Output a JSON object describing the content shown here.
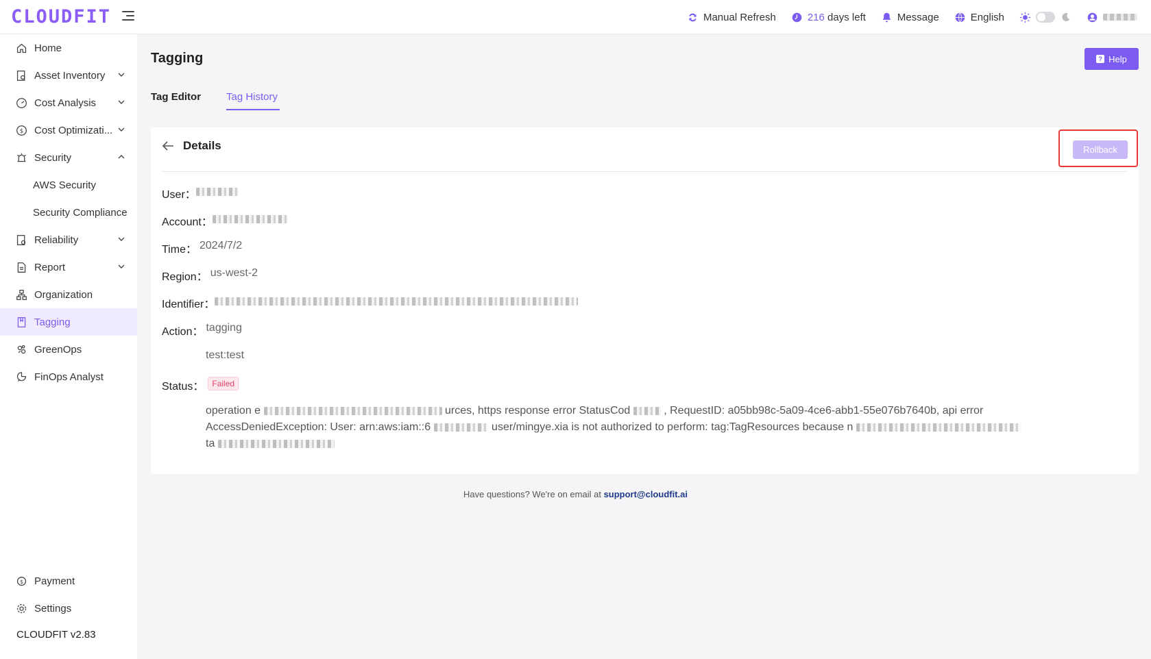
{
  "header": {
    "logo": "CLOUDFIT",
    "manual_refresh": "Manual Refresh",
    "days_num": "216",
    "days_label": "days left",
    "message": "Message",
    "language": "English"
  },
  "sidebar": {
    "items": [
      {
        "label": "Home"
      },
      {
        "label": "Asset Inventory"
      },
      {
        "label": "Cost Analysis"
      },
      {
        "label": "Cost Optimizati..."
      },
      {
        "label": "Security"
      },
      {
        "label": "AWS Security"
      },
      {
        "label": "Security Compliance"
      },
      {
        "label": "Reliability"
      },
      {
        "label": "Report"
      },
      {
        "label": "Organization"
      },
      {
        "label": "Tagging"
      },
      {
        "label": "GreenOps"
      },
      {
        "label": "FinOps Analyst"
      }
    ],
    "payment": "Payment",
    "settings": "Settings",
    "version": "CLOUDFIT v2.83"
  },
  "page": {
    "title": "Tagging",
    "help": "Help",
    "tabs": [
      {
        "label": "Tag Editor"
      },
      {
        "label": "Tag History"
      }
    ],
    "active_tab": "Tag History"
  },
  "details": {
    "title": "Details",
    "rollback": "Rollback",
    "user_label": "User：",
    "account_label": "Account：",
    "time_label": "Time：",
    "time_value": "2024/7/2",
    "region_label": "Region：",
    "region_value": "us-west-2",
    "identifier_label": "Identifier：",
    "action_label": "Action：",
    "action_value": "tagging",
    "tag_value": "test:test",
    "status_label": "Status：",
    "status_value": "Failed",
    "error_line1_a": "operation e",
    "error_line1_b": "urces, https response error StatusCod",
    "error_line1_c": ", RequestID: a05bb98c-5a09-4ce6-abb1-55e076b7640b, api error",
    "error_line2_a": "AccessDeniedException: User: arn:aws:iam::6",
    "error_line2_b": "user/mingye.xia is not authorized to perform: tag:TagResources because n",
    "error_line3_a": "ta"
  },
  "footer": {
    "text": "Have questions? We're on email at ",
    "email": "support@cloudfit.ai"
  },
  "colors": {
    "accent": "#7c5cf0",
    "highlight_border": "#e53935",
    "status_failed": "#e0446a"
  }
}
